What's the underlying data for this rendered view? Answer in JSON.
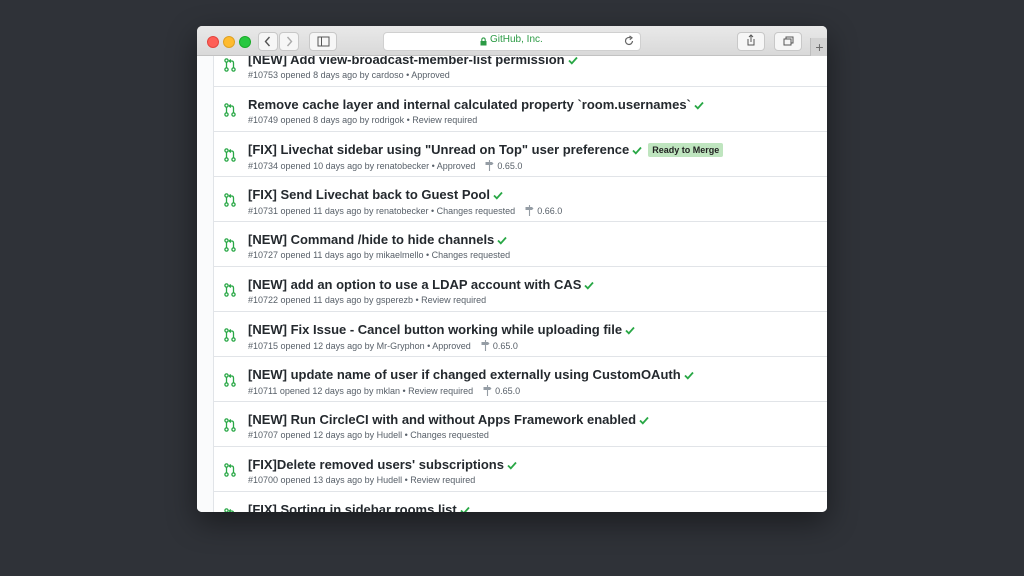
{
  "browser": {
    "address_text": "GitHub, Inc.",
    "nav_back": "<",
    "nav_forward": ">",
    "new_tab": "+"
  },
  "colors": {
    "accent_green": "#28a745",
    "label_ready": "#bfe5bf",
    "url_green": "#2b9a44"
  },
  "pull_requests": [
    {
      "title": "[NEW] Add view-broadcast-member-list permission",
      "meta": "#10753 opened 8 days ago by cardoso • Approved",
      "milestone": "",
      "label": ""
    },
    {
      "title": "Remove cache layer and internal calculated property `room.usernames`",
      "meta": "#10749 opened 8 days ago by rodrigok • Review required",
      "milestone": "",
      "label": ""
    },
    {
      "title": "[FIX] Livechat sidebar using \"Unread on Top\" user preference",
      "meta": "#10734 opened 10 days ago by renatobecker • Approved",
      "milestone": "0.65.0",
      "label": "Ready to Merge"
    },
    {
      "title": "[FIX] Send Livechat back to Guest Pool",
      "meta": "#10731 opened 11 days ago by renatobecker • Changes requested",
      "milestone": "0.66.0",
      "label": ""
    },
    {
      "title": "[NEW] Command /hide to hide channels",
      "meta": "#10727 opened 11 days ago by mikaelmello • Changes requested",
      "milestone": "",
      "label": ""
    },
    {
      "title": "[NEW] add an option to use a LDAP account with CAS",
      "meta": "#10722 opened 11 days ago by gsperezb • Review required",
      "milestone": "",
      "label": ""
    },
    {
      "title": "[NEW] Fix Issue - Cancel button working while uploading file",
      "meta": "#10715 opened 12 days ago by Mr-Gryphon • Approved",
      "milestone": "0.65.0",
      "label": ""
    },
    {
      "title": "[NEW] update name of user if changed externally using CustomOAuth",
      "meta": "#10711 opened 12 days ago by mklan • Review required",
      "milestone": "0.65.0",
      "label": ""
    },
    {
      "title": "[NEW] Run CircleCI with and without Apps Framework enabled",
      "meta": "#10707 opened 12 days ago by Hudell • Changes requested",
      "milestone": "",
      "label": ""
    },
    {
      "title": "[FIX]Delete removed users' subscriptions",
      "meta": "#10700 opened 13 days ago by Hudell • Review required",
      "milestone": "",
      "label": ""
    },
    {
      "title": "[FIX] Sorting in sidebar rooms list",
      "meta": "",
      "milestone": "",
      "label": ""
    }
  ]
}
